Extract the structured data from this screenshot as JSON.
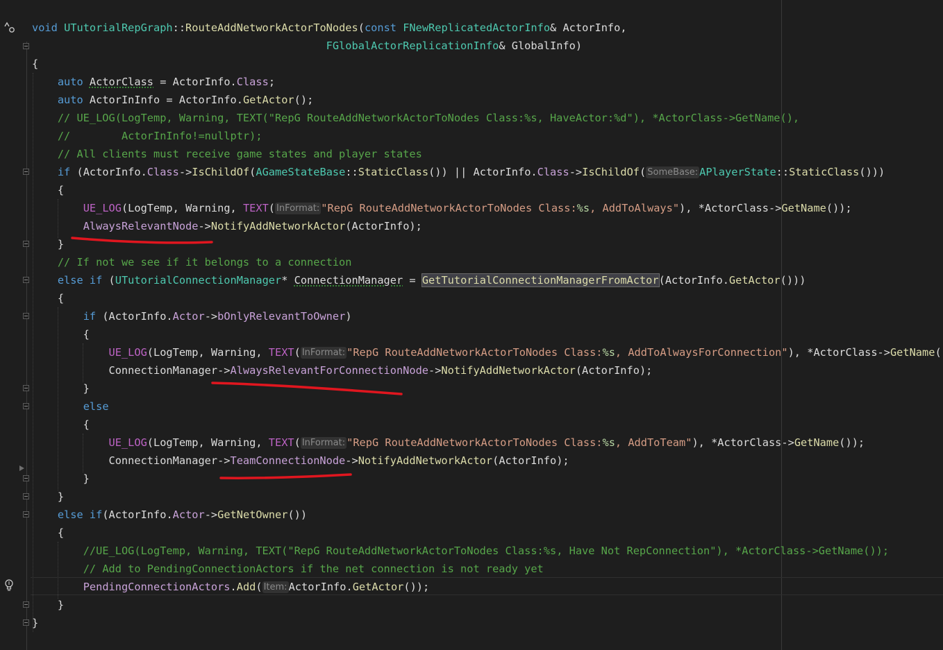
{
  "editor": {
    "lines": [
      [
        [
          "kw",
          "void"
        ],
        [
          "pl",
          " "
        ],
        [
          "ty",
          "UTutorialRepGraph"
        ],
        [
          "pl",
          "::"
        ],
        [
          "fn",
          "RouteAddNetworkActorToNodes"
        ],
        [
          "pl",
          "("
        ],
        [
          "kw",
          "const"
        ],
        [
          "pl",
          " "
        ],
        [
          "ty",
          "FNewReplicatedActorInfo"
        ],
        [
          "pl",
          "& "
        ],
        [
          "va",
          "ActorInfo"
        ],
        [
          "pl",
          ","
        ]
      ],
      [
        [
          "pl",
          "                                              "
        ],
        [
          "ty",
          "FGlobalActorReplicationInfo"
        ],
        [
          "pl",
          "& "
        ],
        [
          "va",
          "GlobalInfo"
        ],
        [
          "pl",
          ")"
        ]
      ],
      [
        [
          "pl",
          "{"
        ]
      ],
      [
        [
          "pl",
          "    "
        ],
        [
          "kw",
          "auto"
        ],
        [
          "pl",
          " "
        ],
        [
          "sq",
          "ActorClass"
        ],
        [
          "pl",
          " = "
        ],
        [
          "va",
          "ActorInfo"
        ],
        [
          "pl",
          "."
        ],
        [
          "cls",
          "Class"
        ],
        [
          "pl",
          ";"
        ]
      ],
      [
        [
          "pl",
          "    "
        ],
        [
          "kw",
          "auto"
        ],
        [
          "pl",
          " "
        ],
        [
          "va",
          "ActorInInfo"
        ],
        [
          "pl",
          " = "
        ],
        [
          "va",
          "ActorInfo"
        ],
        [
          "pl",
          "."
        ],
        [
          "fn",
          "GetActor"
        ],
        [
          "pl",
          "();"
        ]
      ],
      [
        [
          "pl",
          "    "
        ],
        [
          "cm",
          "// UE_LOG(LogTemp, Warning, TEXT(\"RepG RouteAddNetworkActorToNodes Class:%s, HaveActor:%d\"), *ActorClass->GetName(),"
        ]
      ],
      [
        [
          "pl",
          "    "
        ],
        [
          "cm",
          "//        ActorInInfo!=nullptr);"
        ]
      ],
      [
        [
          "pl",
          "    "
        ],
        [
          "cm",
          "// All clients must receive game states and player states"
        ]
      ],
      [
        [
          "pl",
          "    "
        ],
        [
          "kw",
          "if"
        ],
        [
          "pl",
          " ("
        ],
        [
          "va",
          "ActorInfo"
        ],
        [
          "pl",
          "."
        ],
        [
          "cls",
          "Class"
        ],
        [
          "pl",
          "->"
        ],
        [
          "fn",
          "IsChildOf"
        ],
        [
          "pl",
          "("
        ],
        [
          "ty",
          "AGameStateBase"
        ],
        [
          "pl",
          "::"
        ],
        [
          "fn",
          "StaticClass"
        ],
        [
          "pl",
          "()) || "
        ],
        [
          "va",
          "ActorInfo"
        ],
        [
          "pl",
          "."
        ],
        [
          "cls",
          "Class"
        ],
        [
          "pl",
          "->"
        ],
        [
          "fn",
          "IsChildOf"
        ],
        [
          "pl",
          "("
        ],
        [
          "hint",
          "SomeBase:"
        ],
        [
          "ty",
          "APlayerState"
        ],
        [
          "pl",
          "::"
        ],
        [
          "fn",
          "StaticClass"
        ],
        [
          "pl",
          "()))"
        ]
      ],
      [
        [
          "pl",
          "    {"
        ]
      ],
      [
        [
          "pl",
          "        "
        ],
        [
          "mac",
          "UE_LOG"
        ],
        [
          "pl",
          "("
        ],
        [
          "va",
          "LogTemp"
        ],
        [
          "pl",
          ", "
        ],
        [
          "va",
          "Warning"
        ],
        [
          "pl",
          ", "
        ],
        [
          "mac",
          "TEXT"
        ],
        [
          "pl",
          "("
        ],
        [
          "hint",
          "InFormat:"
        ],
        [
          "str",
          "\"RepG RouteAddNetworkActorToNodes Class:"
        ],
        [
          "fmt",
          "%s"
        ],
        [
          "str",
          ", AddToAlways\""
        ],
        [
          "pl",
          "), *"
        ],
        [
          "va",
          "ActorClass"
        ],
        [
          "pl",
          "->"
        ],
        [
          "fn",
          "GetName"
        ],
        [
          "pl",
          "());"
        ]
      ],
      [
        [
          "pl",
          "        "
        ],
        [
          "cls",
          "AlwaysRelevantNode"
        ],
        [
          "pl",
          "->"
        ],
        [
          "fn",
          "NotifyAddNetworkActor"
        ],
        [
          "pl",
          "("
        ],
        [
          "va",
          "ActorInfo"
        ],
        [
          "pl",
          ");"
        ]
      ],
      [
        [
          "pl",
          "    }"
        ]
      ],
      [
        [
          "pl",
          "    "
        ],
        [
          "cm",
          "// If not we see if it belongs to a connection"
        ]
      ],
      [
        [
          "pl",
          "    "
        ],
        [
          "kw",
          "else"
        ],
        [
          "pl",
          " "
        ],
        [
          "kw",
          "if"
        ],
        [
          "pl",
          " ("
        ],
        [
          "ty",
          "UTutorialConnectionManager"
        ],
        [
          "pl",
          "* "
        ],
        [
          "sq",
          "ConnectionManager"
        ],
        [
          "pl",
          " = "
        ],
        [
          "hl",
          "GetTutorialConnectionManagerFromActor"
        ],
        [
          "pl",
          "("
        ],
        [
          "va",
          "ActorInfo"
        ],
        [
          "pl",
          "."
        ],
        [
          "fn",
          "GetActor"
        ],
        [
          "pl",
          "()))"
        ]
      ],
      [
        [
          "pl",
          "    {"
        ]
      ],
      [
        [
          "pl",
          "        "
        ],
        [
          "kw",
          "if"
        ],
        [
          "pl",
          " ("
        ],
        [
          "va",
          "ActorInfo"
        ],
        [
          "pl",
          "."
        ],
        [
          "cls",
          "Actor"
        ],
        [
          "pl",
          "->"
        ],
        [
          "cls",
          "bOnlyRelevantToOwner"
        ],
        [
          "pl",
          ")"
        ]
      ],
      [
        [
          "pl",
          "        {"
        ]
      ],
      [
        [
          "pl",
          "            "
        ],
        [
          "mac",
          "UE_LOG"
        ],
        [
          "pl",
          "("
        ],
        [
          "va",
          "LogTemp"
        ],
        [
          "pl",
          ", "
        ],
        [
          "va",
          "Warning"
        ],
        [
          "pl",
          ", "
        ],
        [
          "mac",
          "TEXT"
        ],
        [
          "pl",
          "("
        ],
        [
          "hint",
          "InFormat:"
        ],
        [
          "str",
          "\"RepG RouteAddNetworkActorToNodes Class:"
        ],
        [
          "fmt",
          "%s"
        ],
        [
          "str",
          ", AddToAlwaysForConnection\""
        ],
        [
          "pl",
          "), *"
        ],
        [
          "va",
          "ActorClass"
        ],
        [
          "pl",
          "->"
        ],
        [
          "fn",
          "GetName"
        ],
        [
          "pl",
          "())"
        ]
      ],
      [
        [
          "pl",
          "            "
        ],
        [
          "va",
          "ConnectionManager"
        ],
        [
          "pl",
          "->"
        ],
        [
          "cls",
          "AlwaysRelevantForConnectionNode"
        ],
        [
          "pl",
          "->"
        ],
        [
          "fn",
          "NotifyAddNetworkActor"
        ],
        [
          "pl",
          "("
        ],
        [
          "va",
          "ActorInfo"
        ],
        [
          "pl",
          ");"
        ]
      ],
      [
        [
          "pl",
          "        }"
        ]
      ],
      [
        [
          "pl",
          "        "
        ],
        [
          "kw",
          "else"
        ]
      ],
      [
        [
          "pl",
          "        {"
        ]
      ],
      [
        [
          "pl",
          "            "
        ],
        [
          "mac",
          "UE_LOG"
        ],
        [
          "pl",
          "("
        ],
        [
          "va",
          "LogTemp"
        ],
        [
          "pl",
          ", "
        ],
        [
          "va",
          "Warning"
        ],
        [
          "pl",
          ", "
        ],
        [
          "mac",
          "TEXT"
        ],
        [
          "pl",
          "("
        ],
        [
          "hint",
          "InFormat:"
        ],
        [
          "str",
          "\"RepG RouteAddNetworkActorToNodes Class:"
        ],
        [
          "fmt",
          "%s"
        ],
        [
          "str",
          ", AddToTeam\""
        ],
        [
          "pl",
          "), *"
        ],
        [
          "va",
          "ActorClass"
        ],
        [
          "pl",
          "->"
        ],
        [
          "fn",
          "GetName"
        ],
        [
          "pl",
          "());"
        ]
      ],
      [
        [
          "pl",
          "            "
        ],
        [
          "va",
          "ConnectionManager"
        ],
        [
          "pl",
          "->"
        ],
        [
          "cls",
          "TeamConnectionNode"
        ],
        [
          "pl",
          "->"
        ],
        [
          "fn",
          "NotifyAddNetworkActor"
        ],
        [
          "pl",
          "("
        ],
        [
          "va",
          "ActorInfo"
        ],
        [
          "pl",
          ");"
        ]
      ],
      [
        [
          "pl",
          "        }"
        ]
      ],
      [
        [
          "pl",
          "    }"
        ]
      ],
      [
        [
          "pl",
          "    "
        ],
        [
          "kw",
          "else"
        ],
        [
          "pl",
          " "
        ],
        [
          "kw",
          "if"
        ],
        [
          "pl",
          "("
        ],
        [
          "va",
          "ActorInfo"
        ],
        [
          "pl",
          "."
        ],
        [
          "cls",
          "Actor"
        ],
        [
          "pl",
          "->"
        ],
        [
          "fn",
          "GetNetOwner"
        ],
        [
          "pl",
          "())"
        ]
      ],
      [
        [
          "pl",
          "    {"
        ]
      ],
      [
        [
          "pl",
          "        "
        ],
        [
          "cm",
          "//UE_LOG(LogTemp, Warning, TEXT(\"RepG RouteAddNetworkActorToNodes Class:%s, Have Not RepConnection\"), *ActorClass->GetName());"
        ]
      ],
      [
        [
          "pl",
          "        "
        ],
        [
          "cm",
          "// Add to PendingConnectionActors if the net connection is not ready yet"
        ]
      ],
      [
        [
          "pl",
          "        "
        ],
        [
          "cls",
          "PendingConnectionActors"
        ],
        [
          "pl",
          "."
        ],
        [
          "fn",
          "Add"
        ],
        [
          "pl",
          "("
        ],
        [
          "hint",
          "Item:"
        ],
        [
          "va",
          "ActorInfo"
        ],
        [
          "pl",
          "."
        ],
        [
          "fn",
          "GetActor"
        ],
        [
          "pl",
          "());"
        ]
      ],
      [
        [
          "pl",
          "    }"
        ]
      ],
      [
        [
          "pl",
          "}"
        ]
      ]
    ]
  },
  "gutter_icons": {
    "top": "quick-info-icon",
    "current": "lightbulb-icon",
    "breakpoint_arrow": "play-arrow-icon"
  },
  "colors": {
    "background": "#1e1e1e",
    "annotation_ink": "#e0161f"
  }
}
